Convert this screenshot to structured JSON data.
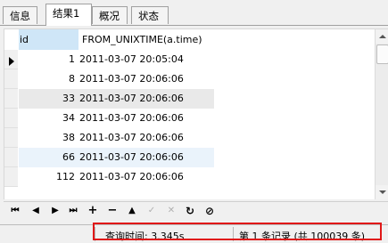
{
  "tabs": [
    {
      "label": "信息"
    },
    {
      "label": "结果1"
    },
    {
      "label": "概况"
    },
    {
      "label": "状态"
    }
  ],
  "grid": {
    "columns": [
      "id",
      "FROM_UNIXTIME(a.time)"
    ],
    "rows": [
      {
        "id": "1",
        "time": "2011-03-07 20:05:04"
      },
      {
        "id": "8",
        "time": "2011-03-07 20:06:06"
      },
      {
        "id": "33",
        "time": "2011-03-07 20:06:06"
      },
      {
        "id": "34",
        "time": "2011-03-07 20:06:06"
      },
      {
        "id": "38",
        "time": "2011-03-07 20:06:06"
      },
      {
        "id": "66",
        "time": "2011-03-07 20:06:06"
      },
      {
        "id": "112",
        "time": "2011-03-07 20:06:06"
      }
    ]
  },
  "nav": {
    "first": "⏮",
    "prev": "◀",
    "next": "▶",
    "last": "⏭",
    "add": "+",
    "delete": "−",
    "up": "▲",
    "apply": "✓",
    "discard": "✕",
    "refresh": "↻",
    "stop": "⊘"
  },
  "status": {
    "query_time": "查询时间: 3.345s",
    "record_info": "第 1 条记录 (共 100039 条)"
  }
}
